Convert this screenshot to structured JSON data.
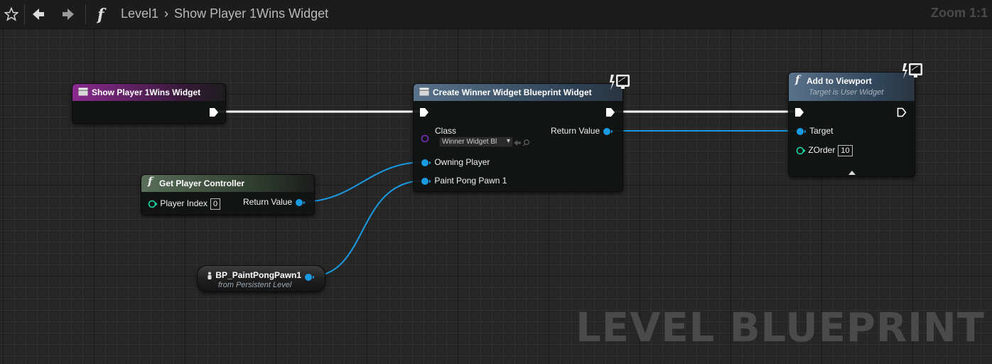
{
  "toolbar": {
    "breadcrumb_root": "Level1",
    "breadcrumb_current": "Show Player 1Wins Widget",
    "zoom": "Zoom 1:1"
  },
  "watermark": "LEVEL BLUEPRINT",
  "nodes": {
    "event": {
      "title": "Show Player 1Wins Widget"
    },
    "get_pc": {
      "title": "Get Player Controller",
      "player_index_label": "Player Index",
      "player_index_value": "0",
      "return_label": "Return Value"
    },
    "pawn_ref": {
      "title": "BP_PaintPongPawn1",
      "subtitle": "from Persistent Level"
    },
    "create_widget": {
      "title": "Create Winner Widget Blueprint Widget",
      "class_label": "Class",
      "class_value": "Winner Widget Bl",
      "return_label": "Return Value",
      "owning_player_label": "Owning Player",
      "paint_pong_label": "Paint Pong Pawn 1"
    },
    "add_viewport": {
      "title": "Add to Viewport",
      "subtitle": "Target is User Widget",
      "target_label": "Target",
      "zorder_label": "ZOrder",
      "zorder_value": "10"
    }
  },
  "colors": {
    "exec_wire": "#ffffff",
    "object_wire": "#1a9ae0",
    "class_pin": "#7b2fbf",
    "int_pin": "#1fd6a8",
    "event_header": "#8a2a8f",
    "func_header": "#5a6e5a",
    "call_header": "#58728a"
  },
  "icons": [
    "star-icon",
    "back-arrow-icon",
    "forward-arrow-icon",
    "function-icon",
    "chevron-right-icon",
    "event-icon",
    "monitor-icon",
    "actor-icon"
  ]
}
